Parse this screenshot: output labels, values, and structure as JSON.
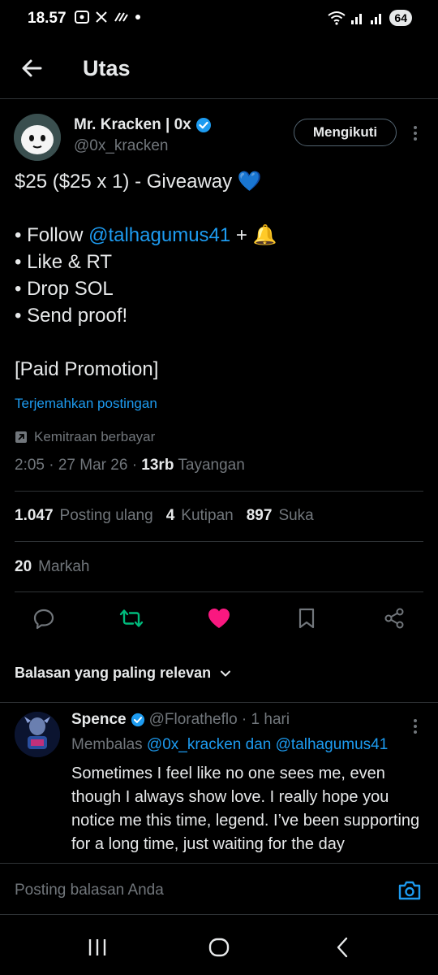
{
  "status_bar": {
    "time": "18.57",
    "battery": "64"
  },
  "header": {
    "title": "Utas"
  },
  "tweet": {
    "author_name": "Mr. Kracken | 0x",
    "author_handle": "@0x_kracken",
    "follow_label": "Mengikuti",
    "line1": "$25 ($25 x 1) - Giveaway 💙",
    "line2_prefix": "• Follow ",
    "line2_mention": "@talhagumus41",
    "line2_suffix": " + 🔔",
    "line3": "• Like & RT",
    "line4": "• Drop SOL",
    "line5": "• Send proof!",
    "line6": "[Paid Promotion]",
    "translate": "Terjemahkan postingan",
    "paid_partnership": "Kemitraan berbayar",
    "time_date": "2:05 · 27 Mar 26 · ",
    "views_count": "13rb",
    "views_label": "Tayangan"
  },
  "stats": {
    "reposts_count": "1.047",
    "reposts_label": "Posting ulang",
    "quotes_count": "4",
    "quotes_label": "Kutipan",
    "likes_count": "897",
    "likes_label": "Suka",
    "bookmarks_count": "20",
    "bookmarks_label": "Markah"
  },
  "sort": {
    "label": "Balasan yang paling relevan"
  },
  "reply": {
    "name": "Spence",
    "handle": "@Floratheflo · 1 hari",
    "replying_prefix": "Membalas ",
    "replying_to1": "@0x_kracken",
    "replying_and": " dan ",
    "replying_to2": "@talhagumus41",
    "text": "Sometimes I feel like no one sees me, even though I always show love. I really hope you notice me this time, legend. I’ve been supporting for a long time, just waiting for the day"
  },
  "composer": {
    "placeholder": "Posting balasan Anda"
  },
  "colors": {
    "accent": "#1d9bf0",
    "repost_active": "#00ba7c",
    "like_active": "#f91880",
    "muted": "#71767b"
  }
}
